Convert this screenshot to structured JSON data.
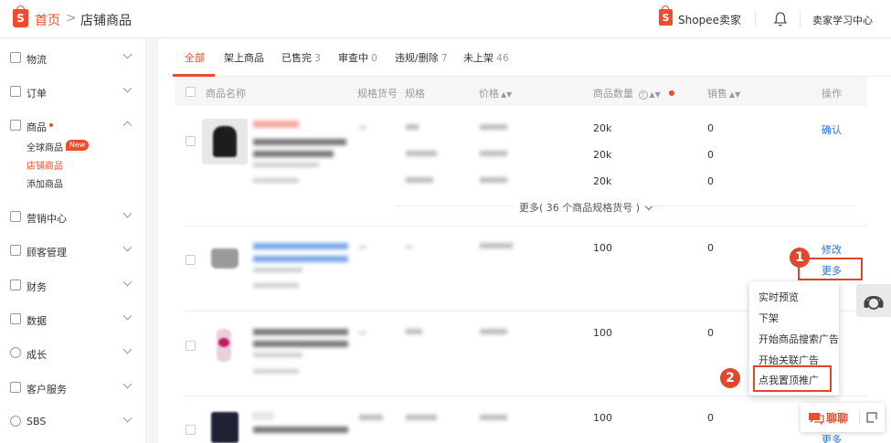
{
  "header": {
    "home": "首页",
    "separator": ">",
    "current": "店铺商品",
    "seller_center": "Shopee卖家",
    "learning_center": "卖家学习中心",
    "logo_letter": "S"
  },
  "sidebar": {
    "items": [
      {
        "label": "物流",
        "icon": "truck-icon"
      },
      {
        "label": "订单",
        "icon": "order-icon"
      },
      {
        "label": "商品",
        "icon": "bag-icon"
      },
      {
        "label": "营销中心",
        "icon": "tag-icon"
      },
      {
        "label": "顾客管理",
        "icon": "user-icon"
      },
      {
        "label": "财务",
        "icon": "wallet-icon"
      },
      {
        "label": "数据",
        "icon": "chart-icon"
      },
      {
        "label": "成长",
        "icon": "growth-icon"
      },
      {
        "label": "客户服务",
        "icon": "service-icon"
      },
      {
        "label": "SBS",
        "icon": "sbs-icon"
      }
    ],
    "sub_items": {
      "all": "全球商品",
      "shop": "店铺商品",
      "add": "添加商品"
    },
    "new_badge": "New"
  },
  "tabs": [
    {
      "label": "全部",
      "count": ""
    },
    {
      "label": "架上商品",
      "count": ""
    },
    {
      "label": "已售完",
      "count": "3"
    },
    {
      "label": "审查中",
      "count": "0"
    },
    {
      "label": "违规/删除",
      "count": "7"
    },
    {
      "label": "未上架",
      "count": "46"
    }
  ],
  "table": {
    "headers": {
      "name": "商品名称",
      "sku": "规格货号",
      "spec": "规格",
      "price": "价格",
      "qty": "商品数量",
      "sales": "销售",
      "action": "操作"
    },
    "rows": [
      {
        "qty": [
          "20k",
          "20k",
          "20k"
        ],
        "sales": [
          "0",
          "0",
          "0"
        ],
        "action": "确认"
      },
      {
        "qty": "100",
        "sales": "0",
        "action_edit": "修改",
        "action_more": "更多"
      },
      {
        "qty": "100",
        "sales": "0"
      },
      {
        "qty": "100",
        "sales": "0",
        "action_more": "更多"
      }
    ],
    "more_variants": "更多( 36 个商品规格货号 )"
  },
  "menu": {
    "items": [
      "实时预览",
      "下架",
      "开始商品搜索广告",
      "开始关联广告",
      "点我置顶推广"
    ]
  },
  "steps": [
    "1",
    "2"
  ],
  "chat": {
    "label": "聊聊"
  },
  "colors": {
    "brand": "#ee4d2d",
    "link": "#2673dd",
    "annotation": "#e0472c"
  }
}
